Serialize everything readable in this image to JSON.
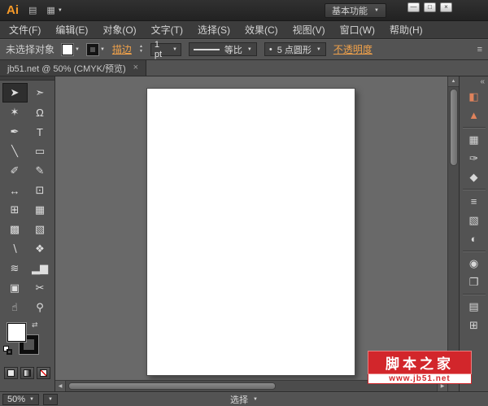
{
  "window": {
    "title_logo": "Ai",
    "workspace": "基本功能"
  },
  "icons": {
    "caret_down": "▼",
    "minimize": "—",
    "maximize": "□",
    "close_window": "×",
    "tab_close": "×",
    "bridge": "▤",
    "arrange_documents": "▦",
    "scroll_up": "▲",
    "scroll_down": "▼",
    "scroll_left": "◀",
    "scroll_right": "▶",
    "swap_arrow": "⇄",
    "bullet": "•",
    "panel_menu": "≡",
    "expand_dock": "«",
    "stepper_up": "▲",
    "stepper_down": "▼"
  },
  "menubar": {
    "items": [
      "文件(F)",
      "编辑(E)",
      "对象(O)",
      "文字(T)",
      "选择(S)",
      "效果(C)",
      "视图(V)",
      "窗口(W)",
      "帮助(H)"
    ]
  },
  "controlbar": {
    "selection_status": "未选择对象",
    "stroke_link": "描边",
    "stroke_width_value": "1 pt",
    "width_profile": "等比",
    "brush_name": "5 点圆形",
    "opacity_link": "不透明度"
  },
  "tab": {
    "title": "jb51.net @ 50% (CMYK/预览)"
  },
  "tools": [
    {
      "name": "selection-tool",
      "glyph": "➤",
      "selected": true
    },
    {
      "name": "direct-selection-tool",
      "glyph": "➣"
    },
    {
      "name": "magic-wand-tool",
      "glyph": "✶"
    },
    {
      "name": "lasso-tool",
      "glyph": "Ω"
    },
    {
      "name": "pen-tool",
      "glyph": "✒"
    },
    {
      "name": "type-tool",
      "glyph": "T"
    },
    {
      "name": "line-segment-tool",
      "glyph": "╲"
    },
    {
      "name": "rectangle-tool",
      "glyph": "▭"
    },
    {
      "name": "paintbrush-tool",
      "glyph": "✐"
    },
    {
      "name": "pencil-tool",
      "glyph": "✎"
    },
    {
      "name": "width-tool",
      "glyph": "↔"
    },
    {
      "name": "free-transform-tool",
      "glyph": "⊡"
    },
    {
      "name": "shape-builder-tool",
      "glyph": "⊞"
    },
    {
      "name": "perspective-grid-tool",
      "glyph": "▦"
    },
    {
      "name": "mesh-tool",
      "glyph": "▩"
    },
    {
      "name": "gradient-tool",
      "glyph": "▧"
    },
    {
      "name": "eyedropper-tool",
      "glyph": "∖"
    },
    {
      "name": "blend-tool",
      "glyph": "❖"
    },
    {
      "name": "symbol-sprayer-tool",
      "glyph": "≋"
    },
    {
      "name": "column-graph-tool",
      "glyph": "▂▆"
    },
    {
      "name": "artboard-tool",
      "glyph": "▣"
    },
    {
      "name": "slice-tool",
      "glyph": "✂"
    },
    {
      "name": "hand-tool",
      "glyph": "☝"
    },
    {
      "name": "zoom-tool",
      "glyph": "⚲"
    }
  ],
  "dock": {
    "icons": [
      {
        "name": "color-panel",
        "glyph": "◧"
      },
      {
        "name": "color-guide-panel",
        "glyph": "▲"
      },
      {
        "name": "swatches-panel",
        "glyph": "▦"
      },
      {
        "name": "brushes-panel",
        "glyph": "✑"
      },
      {
        "name": "symbols-panel",
        "glyph": "◆"
      },
      {
        "name": "stroke-panel",
        "glyph": "≡"
      },
      {
        "name": "gradient-panel",
        "glyph": "▧"
      },
      {
        "name": "transparency-panel",
        "glyph": "◐"
      },
      {
        "name": "appearance-panel",
        "glyph": "◉"
      },
      {
        "name": "graphic-styles-panel",
        "glyph": "❐"
      },
      {
        "name": "layers-panel",
        "glyph": "▤"
      },
      {
        "name": "artboards-panel",
        "glyph": "⊞"
      }
    ]
  },
  "statusbar": {
    "zoom": "50%",
    "tool_status": "选择"
  },
  "watermark": {
    "title": "脚本之家",
    "url": "www.jb51.net"
  },
  "colors": {
    "accent_link": "#F0A14A",
    "logo_amber": "#F79A28",
    "watermark_red": "#D2262B",
    "chrome_gray": "#535353",
    "canvas_gray": "#696969"
  }
}
